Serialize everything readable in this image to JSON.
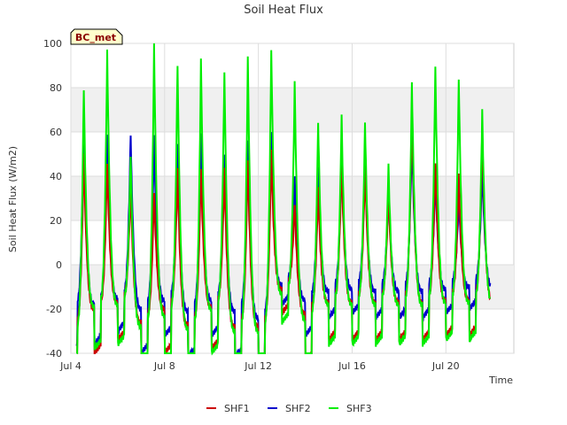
{
  "chart_data": {
    "type": "line",
    "title": "Soil Heat Flux",
    "xlabel": "Time",
    "ylabel": "Soil Heat Flux (W/m2)",
    "badge": "BC_met",
    "ylim": [
      -40,
      100
    ],
    "yticks": [
      -40,
      -20,
      0,
      20,
      40,
      60,
      80,
      100
    ],
    "xlim": [
      4.0,
      22.9
    ],
    "xticks": [
      {
        "value": 4.0,
        "label": "Jul 4"
      },
      {
        "value": 8.0,
        "label": "Jul 8"
      },
      {
        "value": 12.0,
        "label": "Jul 12"
      },
      {
        "value": 16.0,
        "label": "Jul 16"
      },
      {
        "value": 20.0,
        "label": "Jul 20"
      }
    ],
    "grid": true,
    "legend_position": "bottom",
    "day_peaks": [
      {
        "day": 4,
        "min": [
          -28,
          -20,
          -31
        ],
        "max": [
          50,
          62,
          80
        ]
      },
      {
        "day": 5,
        "min": [
          -20,
          -18,
          -19
        ],
        "max": [
          46,
          58,
          96
        ]
      },
      {
        "day": 6,
        "min": [
          -17,
          -15,
          -18
        ],
        "max": [
          36,
          59,
          50
        ]
      },
      {
        "day": 7,
        "min": [
          -26,
          -20,
          -28
        ],
        "max": [
          33,
          58,
          99
        ]
      },
      {
        "day": 8,
        "min": [
          -20,
          -16,
          -23
        ],
        "max": [
          43,
          55,
          91
        ]
      },
      {
        "day": 9,
        "min": [
          -27,
          -21,
          -29
        ],
        "max": [
          44,
          59,
          92
        ]
      },
      {
        "day": 10,
        "min": [
          -19,
          -16,
          -20
        ],
        "max": [
          43,
          50,
          88
        ]
      },
      {
        "day": 11,
        "min": [
          -28,
          -21,
          -30
        ],
        "max": [
          48,
          56,
          93
        ]
      },
      {
        "day": 12,
        "min": [
          -28,
          -24,
          -30
        ],
        "max": [
          51,
          60,
          98
        ]
      },
      {
        "day": 13,
        "min": [
          -11,
          -9,
          -13
        ],
        "max": [
          28,
          40,
          82
        ]
      },
      {
        "day": 14,
        "min": [
          -22,
          -16,
          -25
        ],
        "max": [
          34,
          44,
          65
        ]
      },
      {
        "day": 15,
        "min": [
          -17,
          -12,
          -18
        ],
        "max": [
          47,
          47,
          67
        ]
      },
      {
        "day": 16,
        "min": [
          -17,
          -11,
          -18
        ],
        "max": [
          45,
          46,
          65
        ]
      },
      {
        "day": 17,
        "min": [
          -17,
          -12,
          -18
        ],
        "max": [
          33,
          33,
          45
        ]
      },
      {
        "day": 18,
        "min": [
          -17,
          -12,
          -18
        ],
        "max": [
          72,
          59,
          83
        ]
      },
      {
        "day": 19,
        "min": [
          -17,
          -12,
          -18
        ],
        "max": [
          47,
          40,
          89
        ]
      },
      {
        "day": 20,
        "min": [
          -16,
          -11,
          -17
        ],
        "max": [
          40,
          30,
          84
        ]
      },
      {
        "day": 21,
        "min": [
          -16,
          -10,
          -17
        ],
        "max": [
          62,
          44,
          70
        ]
      }
    ],
    "series": [
      {
        "name": "SHF1",
        "color": "#cc0000"
      },
      {
        "name": "SHF2",
        "color": "#0000cc"
      },
      {
        "name": "SHF3",
        "color": "#00ee00"
      }
    ],
    "data_start": 4.25,
    "data_end": 21.9
  }
}
